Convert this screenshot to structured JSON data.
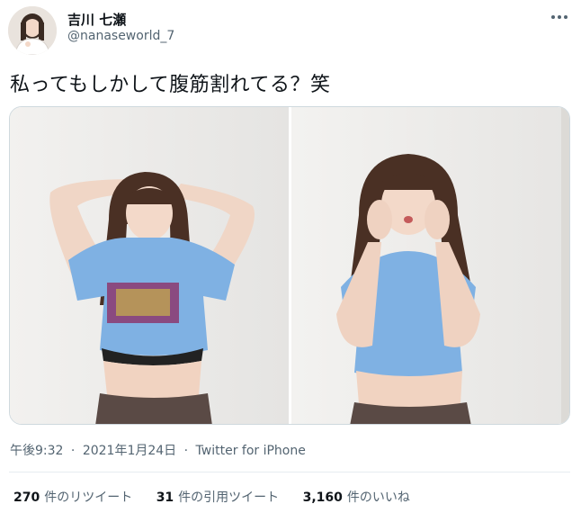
{
  "author": {
    "display_name": "吉川 七瀬",
    "handle": "@nanaseworld_7"
  },
  "tweet": {
    "text": "私ってもしかして腹筋割れてる？笑",
    "time": "午後9:32",
    "separator": "·",
    "date": "2021年1月24日",
    "source": "Twitter for iPhone"
  },
  "stats": [
    {
      "count": "270",
      "label": "件のリツイート"
    },
    {
      "count": "31",
      "label": "件の引用ツイート"
    },
    {
      "count": "3,160",
      "label": "件のいいね"
    }
  ],
  "icons": {
    "more": "more-horizontal-icon",
    "verified": null
  },
  "colors": {
    "text_primary": "#0f1419",
    "text_secondary": "#536471",
    "shirt_blue": "#7fb1e3",
    "wall": "#ecebe9"
  }
}
